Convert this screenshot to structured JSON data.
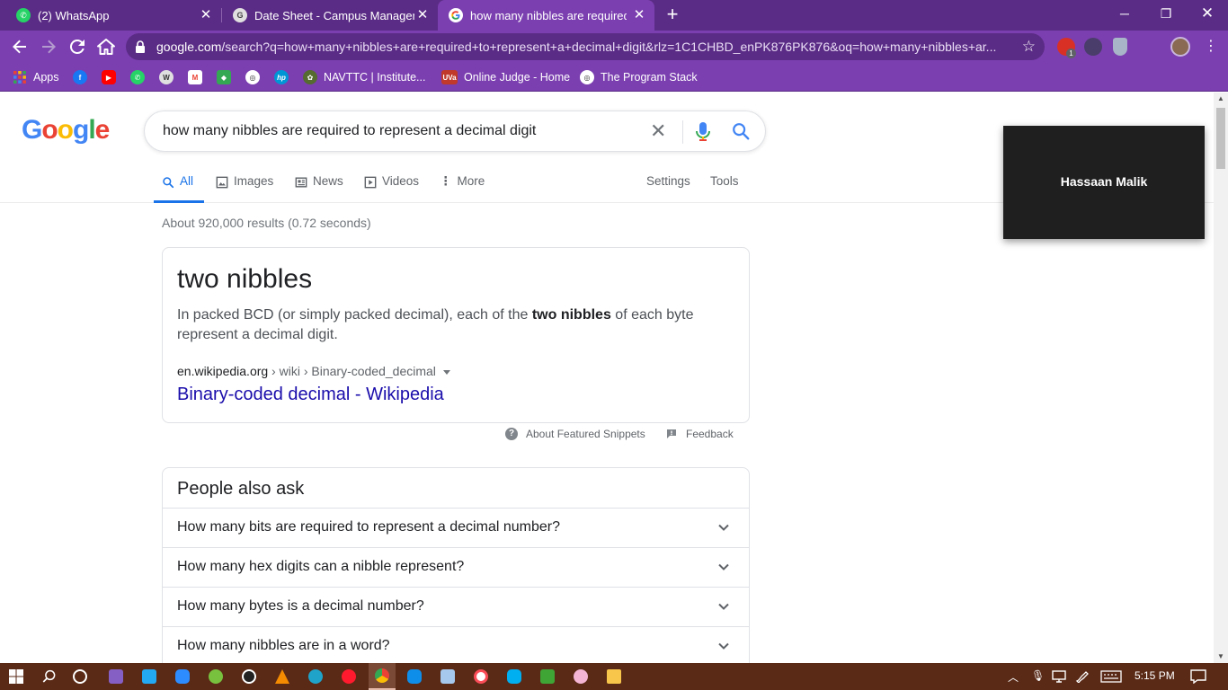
{
  "browser": {
    "tabs": [
      {
        "title": "(2) WhatsApp",
        "active": false,
        "icon": "whatsapp-icon"
      },
      {
        "title": "Date Sheet - Campus Manageme",
        "active": false,
        "icon": "campus-icon"
      },
      {
        "title": "how many nibbles are required t",
        "active": true,
        "icon": "google-icon"
      }
    ],
    "url_domain": "google.com",
    "url_path": "/search?q=how+many+nibbles+are+required+to+represent+a+decimal+digit&rlz=1C1CHBD_enPK876PK876&oq=how+many+nibbles+ar...",
    "extension_badge": "1",
    "bookmarks": [
      {
        "label": "Apps",
        "icon": "apps-grid-icon"
      },
      {
        "label": "",
        "icon": "facebook-icon"
      },
      {
        "label": "",
        "icon": "youtube-icon"
      },
      {
        "label": "",
        "icon": "whatsapp-icon"
      },
      {
        "label": "",
        "icon": "wordpress-icon"
      },
      {
        "label": "",
        "icon": "gmail-icon"
      },
      {
        "label": "",
        "icon": "maps-icon"
      },
      {
        "label": "",
        "icon": "globe-icon"
      },
      {
        "label": "",
        "icon": "hp-icon"
      },
      {
        "label": "NAVTTC | Institute...",
        "icon": "navttc-icon"
      },
      {
        "label": "Online Judge - Home",
        "icon": "uva-icon",
        "icon_text": "UVa"
      },
      {
        "label": "The Program Stack",
        "icon": "globe-icon"
      }
    ]
  },
  "google": {
    "logo": "Google",
    "query": "how many nibbles are required to represent a decimal digit",
    "tabs": [
      {
        "label": "All",
        "icon": "search-icon",
        "active": true
      },
      {
        "label": "Images",
        "icon": "image-icon",
        "active": false
      },
      {
        "label": "News",
        "icon": "news-icon",
        "active": false
      },
      {
        "label": "Videos",
        "icon": "video-icon",
        "active": false
      },
      {
        "label": "More",
        "icon": "more-vert-icon",
        "active": false
      }
    ],
    "settings_label": "Settings",
    "tools_label": "Tools",
    "stats": "About 920,000 results (0.72 seconds)",
    "featured": {
      "answer": "two nibbles",
      "desc_before": "In packed BCD (or simply packed decimal), each of the ",
      "desc_bold": "two nibbles",
      "desc_after": " of each byte represent a decimal digit.",
      "cite_domain": "en.wikipedia.org",
      "cite_path": " › wiki › Binary-coded_decimal",
      "link": "Binary-coded decimal - Wikipedia",
      "about_label": "About Featured Snippets",
      "feedback_label": "Feedback"
    },
    "paa": {
      "heading": "People also ask",
      "questions": [
        "How many bits are required to represent a decimal number?",
        "How many hex digits can a nibble represent?",
        "How many bytes is a decimal number?",
        "How many nibbles are in a word?"
      ]
    }
  },
  "popup": {
    "name": "Hassaan Malik"
  },
  "taskbar": {
    "time": "5:15 PM",
    "apps": [
      "windows-start-icon",
      "search-icon",
      "cortana-icon",
      "visual-studio-icon",
      "vscode-icon",
      "zoom-icon",
      "utorrent-icon",
      "obs-icon",
      "vlc-icon",
      "edge-icon",
      "opera-icon",
      "chrome-icon",
      "teamviewer-icon",
      "virtualbox-icon",
      "itunes-icon",
      "skype-icon",
      "green-app-icon",
      "pink-app-icon",
      "file-explorer-icon"
    ]
  },
  "colors": {
    "chrome_dark": "#5b2c86",
    "chrome_mid": "#7b3fb0",
    "google_blue": "#4285f4",
    "google_red": "#ea4335",
    "google_yellow": "#fbbc05",
    "google_green": "#34a853",
    "link": "#1a0dab",
    "taskbar": "#5a2a17"
  }
}
